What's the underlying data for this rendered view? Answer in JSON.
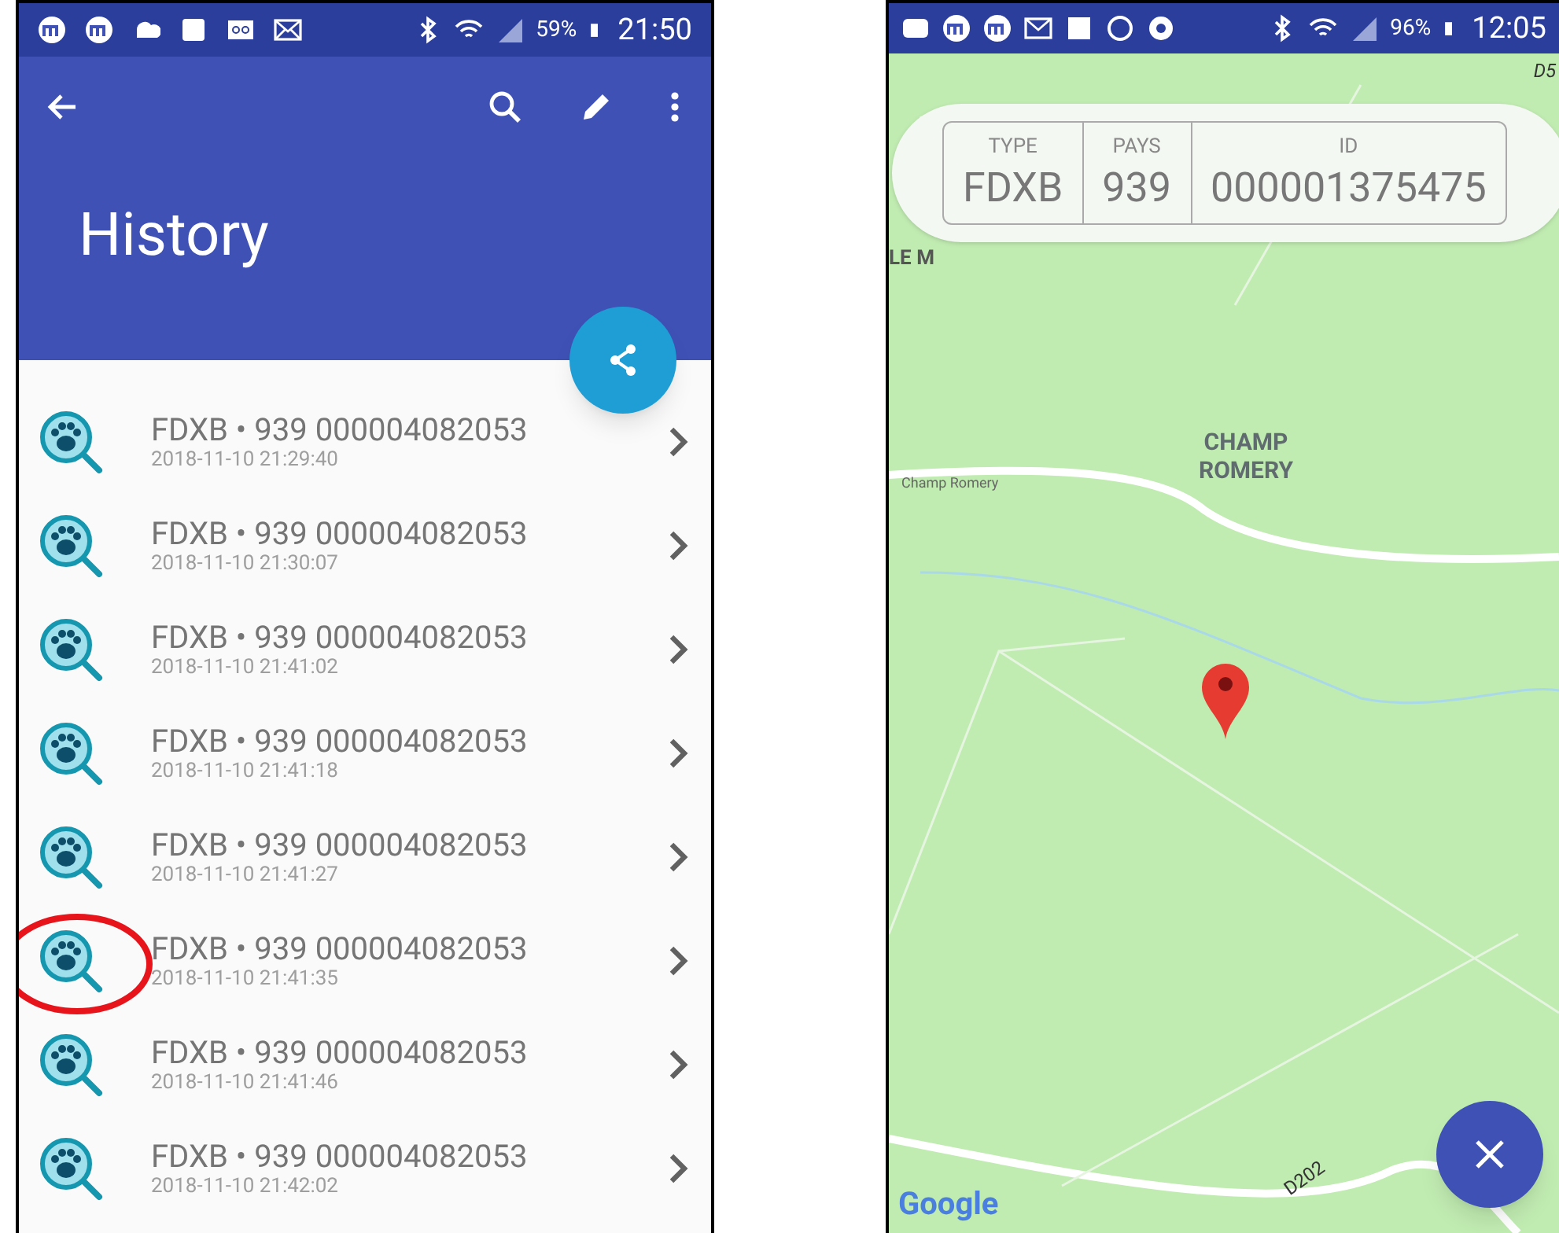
{
  "history_screen": {
    "status_bar": {
      "battery": "59%",
      "time": "21:50"
    },
    "title": "History",
    "rows": [
      {
        "title": "FDXB • 939 000004082053",
        "date": "2018-11-10 21:29:40",
        "circled": false
      },
      {
        "title": "FDXB • 939 000004082053",
        "date": "2018-11-10 21:30:07",
        "circled": false
      },
      {
        "title": "FDXB • 939 000004082053",
        "date": "2018-11-10 21:41:02",
        "circled": false
      },
      {
        "title": "FDXB • 939 000004082053",
        "date": "2018-11-10 21:41:18",
        "circled": false
      },
      {
        "title": "FDXB • 939 000004082053",
        "date": "2018-11-10 21:41:27",
        "circled": false
      },
      {
        "title": "FDXB • 939 000004082053",
        "date": "2018-11-10 21:41:35",
        "circled": true
      },
      {
        "title": "FDXB • 939 000004082053",
        "date": "2018-11-10 21:41:46",
        "circled": false
      },
      {
        "title": "FDXB • 939 000004082053",
        "date": "2018-11-10 21:42:02",
        "circled": false
      }
    ]
  },
  "map_screen": {
    "status_bar": {
      "battery": "96%",
      "time": "12:05"
    },
    "info_card": [
      {
        "label": "TYPE",
        "value": "FDXB"
      },
      {
        "label": "PAYS",
        "value": "939"
      },
      {
        "label": "ID",
        "value": "000001375475"
      }
    ],
    "map_labels": [
      {
        "text": "D5",
        "kind": "route"
      },
      {
        "text": "LE M",
        "kind": "place"
      },
      {
        "text": "CHAMP ROMERY",
        "kind": "area"
      },
      {
        "text": "Champ Romery",
        "kind": "street"
      },
      {
        "text": "D202",
        "kind": "road"
      }
    ],
    "attribution": "Google"
  }
}
